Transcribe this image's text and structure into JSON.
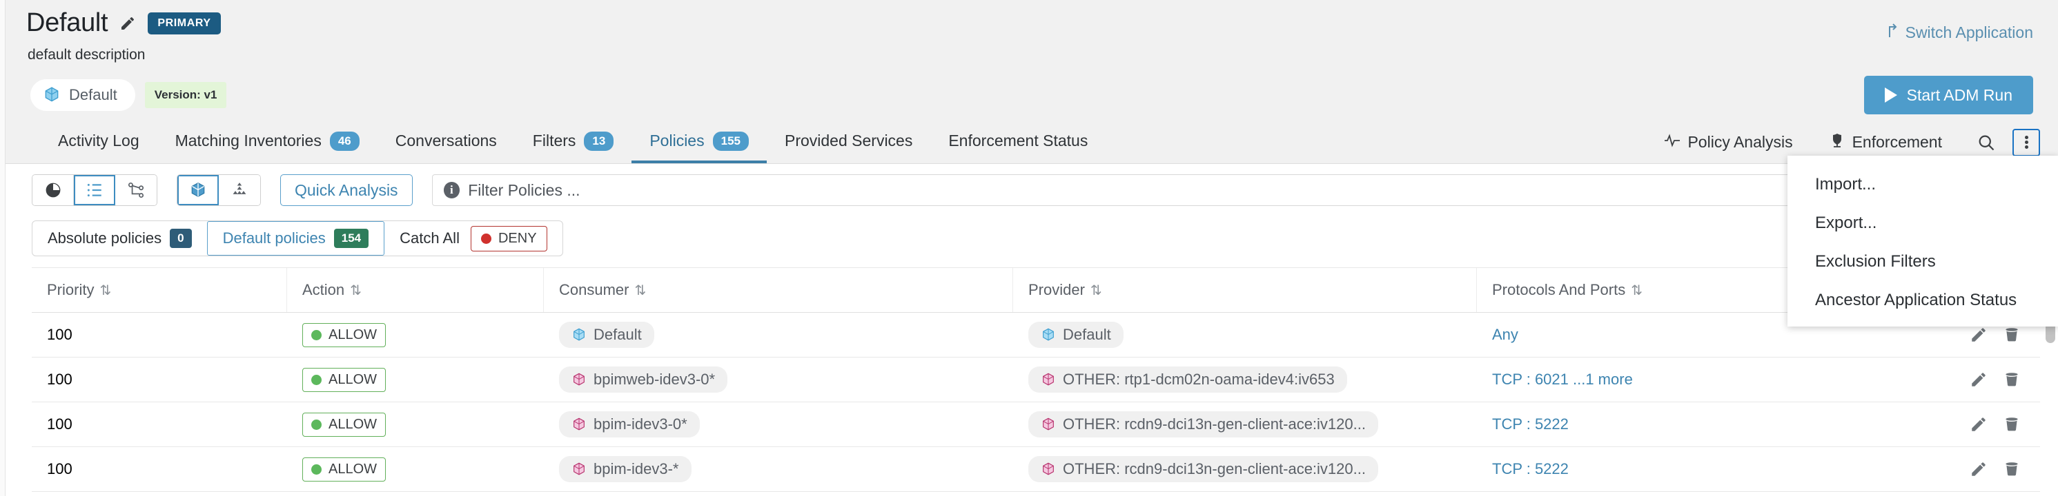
{
  "header": {
    "title": "Default",
    "edit_icon": "pencil-icon",
    "primary_badge": "PRIMARY",
    "description": "default description",
    "scope_chip": "Default",
    "scope_icon": "cube-icon",
    "version_chip": "Version: v1",
    "switch_application": "Switch Application",
    "switch_icon": "arrow-up-right-icon",
    "start_adm": "Start ADM Run",
    "play_icon": "play-icon",
    "accent": "#4e9ccb",
    "primary_badge_color": "#1c5b82"
  },
  "tabs": [
    {
      "label": "Activity Log",
      "count": "",
      "active": false
    },
    {
      "label": "Matching Inventories",
      "count": "46",
      "active": false
    },
    {
      "label": "Conversations",
      "count": "",
      "active": false
    },
    {
      "label": "Filters",
      "count": "13",
      "active": false
    },
    {
      "label": "Policies",
      "count": "155",
      "active": true
    },
    {
      "label": "Provided Services",
      "count": "",
      "active": false
    },
    {
      "label": "Enforcement Status",
      "count": "",
      "active": false
    }
  ],
  "tabbar_actions": {
    "policy_analysis": "Policy Analysis",
    "policy_analysis_icon": "pulse-icon",
    "enforcement": "Enforcement",
    "enforcement_icon": "shield-icon",
    "search_icon": "search-icon",
    "kebab_icon": "kebab-menu-icon"
  },
  "menu": {
    "items": [
      "Import...",
      "Export...",
      "Exclusion Filters",
      "Ancestor Application Status"
    ]
  },
  "toolbar": {
    "view_icons": [
      "pie-chart-icon",
      "list-icon",
      "graph-icon"
    ],
    "view_active_index": 1,
    "scope_icons": [
      "cube-icon",
      "cluster-icon"
    ],
    "scope_active_index": 0,
    "quick_analysis": "Quick Analysis",
    "filter_placeholder": "Filter Policies ...",
    "filter_value": "",
    "filter_info_icon": "info-icon"
  },
  "policy_tabs": {
    "absolute_label": "Absolute policies",
    "absolute_count": "0",
    "default_label": "Default policies",
    "default_count": "154",
    "catch_all_label": "Catch All",
    "catch_all_value": "DENY",
    "catch_all_color": "#d0312d",
    "active": "default"
  },
  "table": {
    "columns": [
      {
        "key": "priority",
        "label": "Priority"
      },
      {
        "key": "action",
        "label": "Action"
      },
      {
        "key": "consumer",
        "label": "Consumer"
      },
      {
        "key": "provider",
        "label": "Provider"
      },
      {
        "key": "ports",
        "label": "Protocols And Ports"
      }
    ],
    "sort_icon": "sort-updown-icon",
    "row_icons": [
      "pencil-icon",
      "trash-icon"
    ],
    "rows": [
      {
        "priority": "100",
        "action": "ALLOW",
        "consumer": "Default",
        "consumer_icon": "cube-blue-icon",
        "provider": "Default",
        "provider_icon": "cube-blue-icon",
        "ports": "Any"
      },
      {
        "priority": "100",
        "action": "ALLOW",
        "consumer": "bpimweb-idev3-0*",
        "consumer_icon": "cube-pink-icon",
        "provider": "OTHER: rtp1-dcm02n-oama-idev4:iv653",
        "provider_icon": "cube-pink-icon",
        "ports": "TCP : 6021 ...1 more"
      },
      {
        "priority": "100",
        "action": "ALLOW",
        "consumer": "bpim-idev3-0*",
        "consumer_icon": "cube-pink-icon",
        "provider": "OTHER: rcdn9-dci13n-gen-client-ace:iv120...",
        "provider_icon": "cube-pink-icon",
        "ports": "TCP : 5222"
      },
      {
        "priority": "100",
        "action": "ALLOW",
        "consumer": "bpim-idev3-*",
        "consumer_icon": "cube-pink-icon",
        "provider": "OTHER: rcdn9-dci13n-gen-client-ace:iv120...",
        "provider_icon": "cube-pink-icon",
        "ports": "TCP : 5222"
      }
    ]
  }
}
